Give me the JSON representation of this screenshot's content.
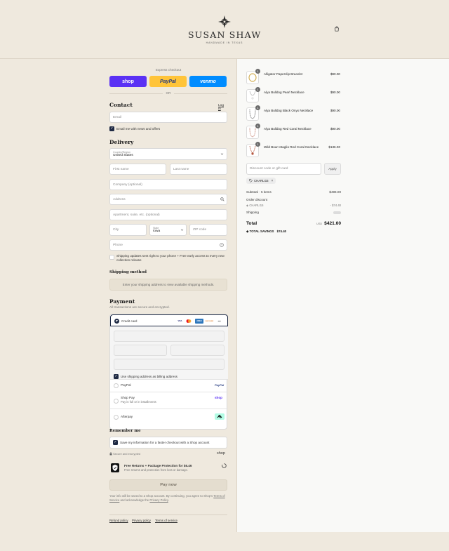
{
  "brand": {
    "name": "SUSAN SHAW",
    "tagline": "HANDMADE IN TEXAS"
  },
  "express": {
    "label": "Express checkout",
    "buttons": [
      {
        "label": "shop",
        "color": "#5a31f4"
      },
      {
        "label": "PayPal",
        "color": "#ffc439"
      },
      {
        "label": "venmo",
        "color": "#008cff"
      }
    ],
    "or": "OR"
  },
  "contact": {
    "heading": "Contact",
    "login": "Log in",
    "email_placeholder": "Email",
    "news_label": "Email me with news and offers"
  },
  "delivery": {
    "heading": "Delivery",
    "country_label": "Country/Region",
    "country_value": "United States",
    "first_name": "First name",
    "last_name": "Last name",
    "company": "Company (optional)",
    "address": "Address",
    "apartment": "Apartment, suite, etc. (optional)",
    "city": "City",
    "state_label": "State",
    "state_value": "Iowa",
    "zip": "ZIP code",
    "phone": "Phone",
    "sms_label": "Shipping updates sent right to your phone + Free early access to every new collection release"
  },
  "shipping_method": {
    "heading": "Shipping method",
    "message": "Enter your shipping address to view available shipping methods."
  },
  "payment": {
    "heading": "Payment",
    "subtitle": "All transactions are secure and encrypted.",
    "credit_card": "Credit card",
    "card_brands": [
      "VISA",
      "MC",
      "AMEX",
      "DISCOVER"
    ],
    "more_cards": "+4",
    "billing_label": "Use shipping address as billing address",
    "paypal": "PayPal",
    "paypal_logo": "PayPal",
    "shop_pay": "Shop Pay",
    "shop_pay_sub": "Pay in full or in installments",
    "shop_pay_logo": "shop",
    "afterpay": "Afterpay"
  },
  "remember": {
    "heading": "Remember me",
    "save_label": "Save my information for a faster checkout with a Shop account",
    "secure": "Secure and encrypted",
    "shop_logo": "shop"
  },
  "protection": {
    "title": "Free Returns + Package Protection for $6.46",
    "subtitle": "Free returns and protection from loss or damage."
  },
  "pay_now": "Pay now",
  "legal": {
    "text_1": "Your info will be saved to a Shop account. By continuing, you agree to Shop's",
    "terms": "Terms of Service",
    "text_2": "and acknowledge the",
    "privacy": "Privacy Policy",
    "text_3": "."
  },
  "footer_links": [
    "Refund policy",
    "Privacy policy",
    "Terms of service"
  ],
  "cart": {
    "items": [
      {
        "name": "Alligator Paperclip Bracelet",
        "price": "$90.00",
        "qty": "1"
      },
      {
        "name": "Alya Bulldog Pearl Necklace",
        "price": "$90.00",
        "qty": "1"
      },
      {
        "name": "Alya Bulldog Black Onyx Necklace",
        "price": "$90.00",
        "qty": "1"
      },
      {
        "name": "Alya Bulldog Red Coral Necklace",
        "price": "$90.00",
        "qty": "1"
      },
      {
        "name": "Wild Boar Intaglio Red Coral Necklace",
        "price": "$136.00",
        "qty": "1"
      }
    ],
    "discount_placeholder": "Discount code or gift card",
    "apply": "Apply",
    "code_chip": "CHARLI15",
    "subtotal_label": "Subtotal · 5 items",
    "subtotal": "$496.00",
    "order_discount_label": "Order discount",
    "discount_code": "CHARLI15",
    "discount_amount": "- $74.40",
    "shipping_label": "Shipping",
    "total_label": "Total",
    "currency": "USD",
    "total": "$421.60",
    "savings_label": "TOTAL SAVINGS",
    "savings": "$74.40"
  }
}
